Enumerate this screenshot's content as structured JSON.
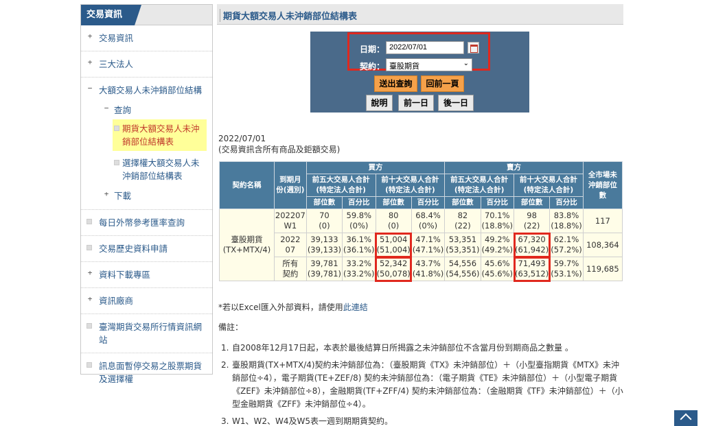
{
  "sidebar": {
    "header": "交易資訊",
    "items": [
      {
        "pm": "+",
        "label": "交易資訊"
      },
      {
        "pm": "+",
        "label": "三大法人"
      },
      {
        "pm": "−",
        "label": "大額交易人未沖銷部位結構"
      },
      {
        "pm": "",
        "label": "每日外幣參考匯率查詢"
      },
      {
        "pm": "",
        "label": "交易歷史資料申請"
      },
      {
        "pm": "+",
        "label": "資料下載專區"
      },
      {
        "pm": "+",
        "label": "資訊廠商"
      },
      {
        "pm": "",
        "label": "臺灣期貨交易所行情資訊網站"
      },
      {
        "pm": "",
        "label": "訊息面暫停交易之股票期貨及選擇權"
      }
    ],
    "sub": {
      "query": {
        "pm": "−",
        "label": "查詢"
      },
      "leaf1": "期貨大額交易人未沖銷部位結構表",
      "leaf2": "選擇權大額交易人未沖銷部位結構表",
      "download": {
        "pm": "+",
        "label": "下載"
      }
    }
  },
  "main": {
    "title": "期貨大額交易人未沖銷部位結構表",
    "query": {
      "date_label": "日期：",
      "date_value": "2022/07/01",
      "contract_label": "契約：",
      "contract_value": "臺股期貨",
      "submit": "送出查詢",
      "back": "回前一頁",
      "explain": "說明",
      "prev_day": "前一日",
      "next_day": "後一日"
    },
    "date_line": "2022/07/01",
    "scope_line": "(交易資訊含所有商品及鉅額交易)",
    "table": {
      "h_contract": "契約名稱",
      "h_month": "到期月份(週別)",
      "h_buy": "買方",
      "h_sell": "賣方",
      "h_top5": "前五大交易人合計(特定法人合計)",
      "h_top10": "前十大交易人合計(特定法人合計)",
      "h_market": "全市場未沖銷部位數",
      "h_pos": "部位數",
      "h_pct": "百分比",
      "contract_name": "臺股期貨",
      "contract_sub": "(TX+MTX/4)",
      "rows": [
        {
          "month_a": "202207",
          "month_b": "W1",
          "cells": [
            [
              "70",
              "(0)"
            ],
            [
              "59.8%",
              "(0%)"
            ],
            [
              "80",
              "(0)"
            ],
            [
              "68.4%",
              "(0%)"
            ],
            [
              "82",
              "(22)"
            ],
            [
              "70.1%",
              "(18.8%)"
            ],
            [
              "98",
              "(22)"
            ],
            [
              "83.8%",
              "(18.8%)"
            ]
          ],
          "market": "117"
        },
        {
          "month_a": "2022",
          "month_b": "07",
          "cells": [
            [
              "39,133",
              "(39,133)"
            ],
            [
              "36.1%",
              "(36.1%)"
            ],
            [
              "51,004",
              "(51,004)"
            ],
            [
              "47.1%",
              "(47.1%)"
            ],
            [
              "53,351",
              "(53,351)"
            ],
            [
              "49.2%",
              "(49.2%)"
            ],
            [
              "67,320",
              "(61,942)"
            ],
            [
              "62.1%",
              "(57.2%)"
            ]
          ],
          "market": "108,364"
        },
        {
          "month_a": "所有",
          "month_b": "契約",
          "cells": [
            [
              "39,781",
              "(39,781)"
            ],
            [
              "33.2%",
              "(33.2%)"
            ],
            [
              "52,342",
              "(50,078)"
            ],
            [
              "43.7%",
              "(41.8%)"
            ],
            [
              "54,556",
              "(54,556)"
            ],
            [
              "45.6%",
              "(45.6%)"
            ],
            [
              "71,493",
              "(63,512)"
            ],
            [
              "59.7%",
              "(53.1%)"
            ]
          ],
          "market": "119,685"
        }
      ]
    },
    "excel_note": "*若以Excel匯入外部資料，請使用",
    "excel_link": "此連結",
    "remarks_title": "備註：",
    "remarks": [
      "自2008年12月17日起，本表於最後結算日所揭露之未沖銷部位不含當月份到期商品之數量 。",
      "臺股期貨(TX+MTX/4)契約未沖銷部位為：（臺股期貨《TX》未沖銷部位）＋（小型臺指期貨《MTX》未沖銷部位÷4），電子期貨(TE+ZEF/8) 契約未沖銷部位為：（電子期貨《TE》未沖銷部位）＋（小型電子期貨《ZEF》未沖銷部位÷8），金融期貨(TF+ZFF/4) 契約未沖銷部位為：（金融期貨《TF》未沖銷部位）＋（小型金融期貨《ZFF》未沖銷部位÷4）。",
      "W1、W2、W4及W5表一週到期期貨契約。"
    ],
    "top_label": "TOP"
  }
}
